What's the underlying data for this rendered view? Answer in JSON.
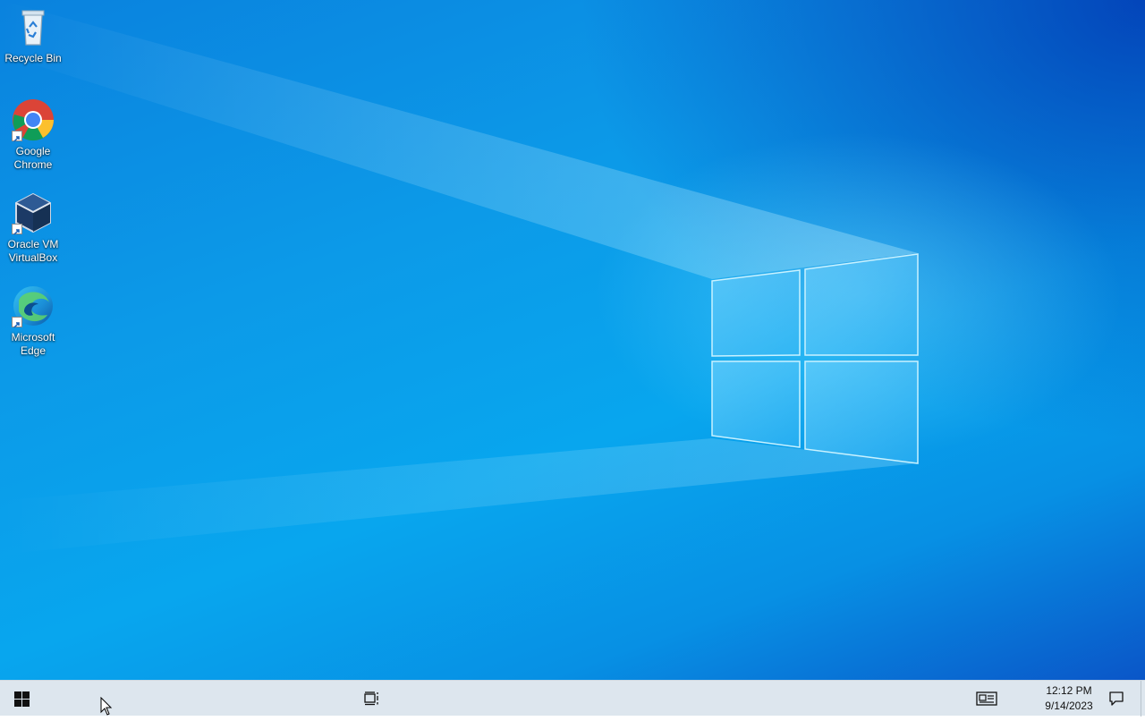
{
  "desktop": {
    "icons": [
      {
        "label": "Recycle Bin",
        "icon": "recycle-bin-icon"
      },
      {
        "label": "Google\nChrome",
        "icon": "chrome-icon"
      },
      {
        "label": "Oracle VM\nVirtualBox",
        "icon": "virtualbox-icon"
      },
      {
        "label": "Microsoft\nEdge",
        "icon": "edge-icon"
      }
    ]
  },
  "taskbar": {
    "start_icon": "windows-logo-icon",
    "task_view_icon": "task-view-icon",
    "news_icon": "news-and-interests-icon",
    "notification_icon": "action-center-icon",
    "clock": {
      "time": "12:12 PM",
      "date": "9/14/2023"
    }
  },
  "colors": {
    "taskbar_bg": "#dde6ee",
    "wallpaper_main": "#0c9ae8",
    "wallpaper_dark": "#0a56c8"
  }
}
